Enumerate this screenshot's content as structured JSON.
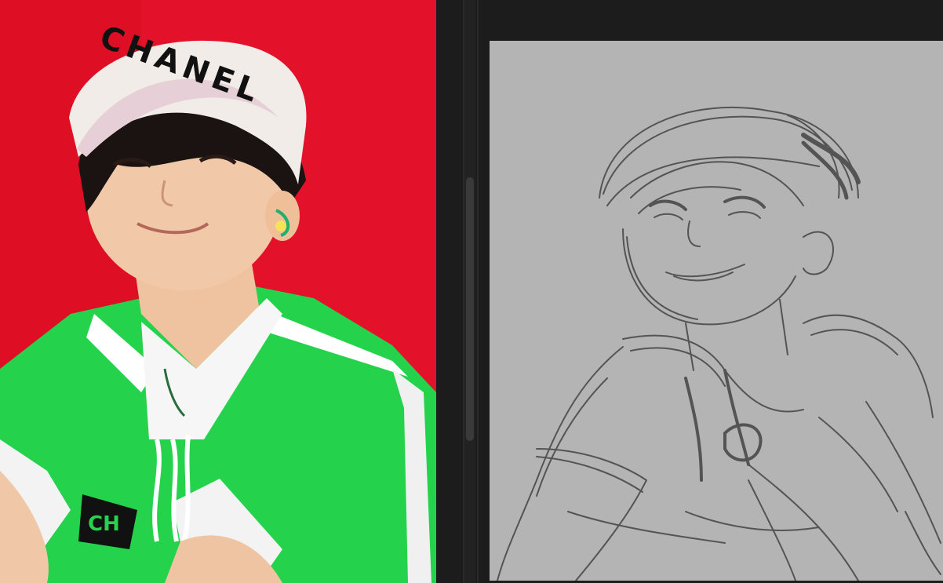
{
  "reference_photo": {
    "cap_text": "CHANEL",
    "shirt_text": "CH",
    "background_color": "#e20f23",
    "shirt_color": "#22d04a"
  },
  "canvas": {
    "background_color": "#b4b4b4",
    "stroke_color": "#4a4a4a"
  },
  "scrollbar": {
    "thumb_color": "#3a3a3a"
  }
}
